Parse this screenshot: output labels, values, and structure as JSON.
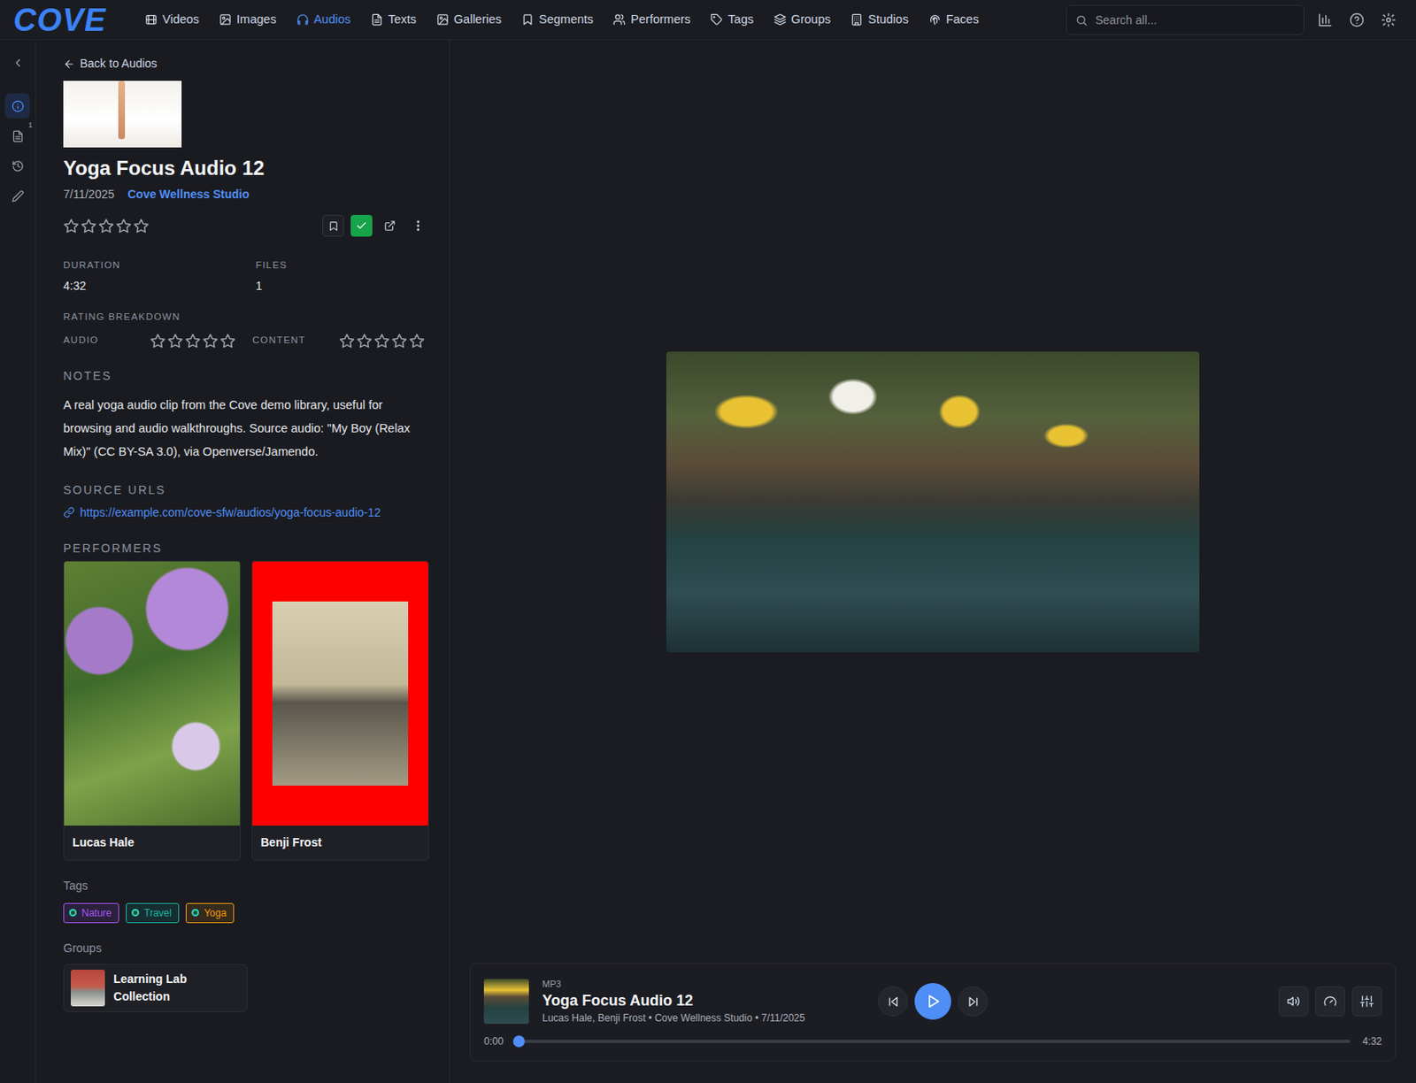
{
  "logo": "COVE",
  "nav": {
    "items": [
      {
        "label": "Videos",
        "selected": false
      },
      {
        "label": "Images",
        "selected": false
      },
      {
        "label": "Audios",
        "selected": true
      },
      {
        "label": "Texts",
        "selected": false
      },
      {
        "label": "Galleries",
        "selected": false
      },
      {
        "label": "Segments",
        "selected": false
      },
      {
        "label": "Performers",
        "selected": false
      },
      {
        "label": "Tags",
        "selected": false
      },
      {
        "label": "Groups",
        "selected": false
      },
      {
        "label": "Studios",
        "selected": false
      },
      {
        "label": "Faces",
        "selected": false
      }
    ]
  },
  "search": {
    "placeholder": "Search all..."
  },
  "rail": {
    "items": [
      {
        "selected": true,
        "badge": ""
      },
      {
        "selected": false,
        "badge": "1"
      },
      {
        "selected": false,
        "badge": ""
      },
      {
        "selected": false,
        "badge": ""
      }
    ]
  },
  "detail": {
    "back": "Back to Audios",
    "title": "Yoga Focus Audio 12",
    "date": "7/11/2025",
    "studio": "Cove Wellness Studio",
    "stars": 0,
    "organized": true,
    "stats": [
      {
        "label": "DURATION",
        "value": "4:32"
      },
      {
        "label": "FILES",
        "value": "1"
      }
    ],
    "rating_breakdown": {
      "label": "RATING BREAKDOWN",
      "items": [
        {
          "label": "AUDIO",
          "stars": 0
        },
        {
          "label": "CONTENT",
          "stars": 0
        }
      ]
    },
    "notes": {
      "label": "NOTES",
      "text": "A real yoga audio clip from the Cove demo library, useful for browsing and audio walkthroughs. Source audio: \"My Boy (Relax Mix)\" (CC BY-SA 3.0), via Openverse/Jamendo."
    },
    "source_urls": {
      "label": "SOURCE URLS",
      "urls": [
        "https://example.com/cove-sfw/audios/yoga-focus-audio-12"
      ]
    },
    "performers": {
      "label": "PERFORMERS",
      "items": [
        {
          "name": "Lucas Hale"
        },
        {
          "name": "Benji Frost"
        }
      ]
    },
    "tags": {
      "label": "Tags",
      "items": [
        {
          "label": "Nature",
          "color": "#a855f7"
        },
        {
          "label": "Travel",
          "color": "#14b8a6"
        },
        {
          "label": "Yoga",
          "color": "#f59e0b"
        }
      ]
    },
    "groups": {
      "label": "Groups",
      "items": [
        {
          "name": "Learning Lab Collection"
        }
      ]
    }
  },
  "player": {
    "format": "MP3",
    "title": "Yoga Focus Audio 12",
    "subtitle": "Lucas Hale, Benji Frost • Cove Wellness Studio • 7/11/2025",
    "current": "0:00",
    "duration": "4:32",
    "level": 0,
    "playing": false
  }
}
